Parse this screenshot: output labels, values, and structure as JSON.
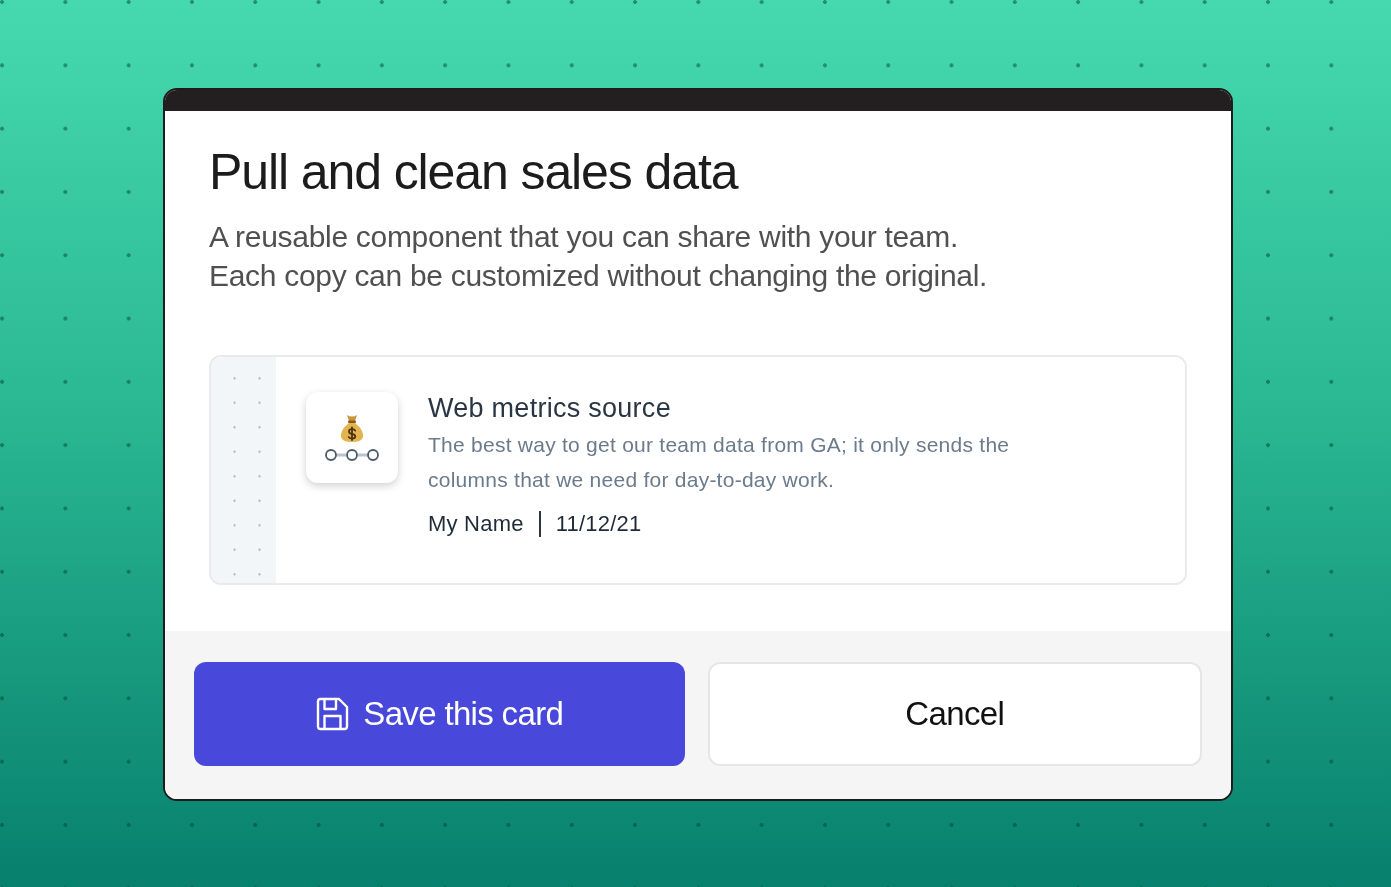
{
  "dialog": {
    "title": "Pull and clean sales data",
    "description_lines": [
      "A reusable component that you can share with your team.",
      "Each copy can be customized without changing the original."
    ],
    "card": {
      "title": "Web metrics source",
      "description": "The best way to get our team data from GA; it only sends the columns that we need for day-to-day work.",
      "author": "My Name",
      "date": "11/12/21"
    },
    "buttons": [
      {
        "label": "Save this card",
        "kind": "primary"
      },
      {
        "label": "Cancel",
        "kind": "secondary"
      }
    ]
  }
}
